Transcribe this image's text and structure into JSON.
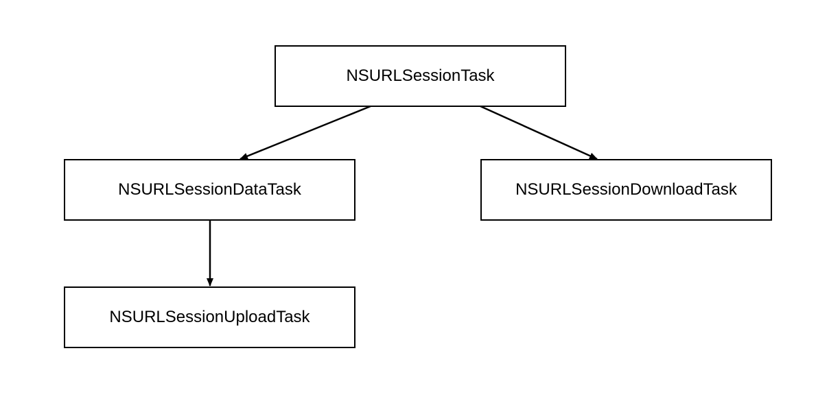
{
  "chart_data": {
    "type": "tree",
    "nodes": [
      {
        "id": "root",
        "label": "NSURLSessionTask"
      },
      {
        "id": "data",
        "label": "NSURLSessionDataTask"
      },
      {
        "id": "download",
        "label": "NSURLSessionDownloadTask"
      },
      {
        "id": "upload",
        "label": "NSURLSessionUploadTask"
      }
    ],
    "edges": [
      {
        "from": "root",
        "to": "data"
      },
      {
        "from": "root",
        "to": "download"
      },
      {
        "from": "data",
        "to": "upload"
      }
    ]
  },
  "nodes": {
    "root": {
      "label": "NSURLSessionTask"
    },
    "data": {
      "label": "NSURLSessionDataTask"
    },
    "download": {
      "label": "NSURLSessionDownloadTask"
    },
    "upload": {
      "label": "NSURLSessionUploadTask"
    }
  }
}
